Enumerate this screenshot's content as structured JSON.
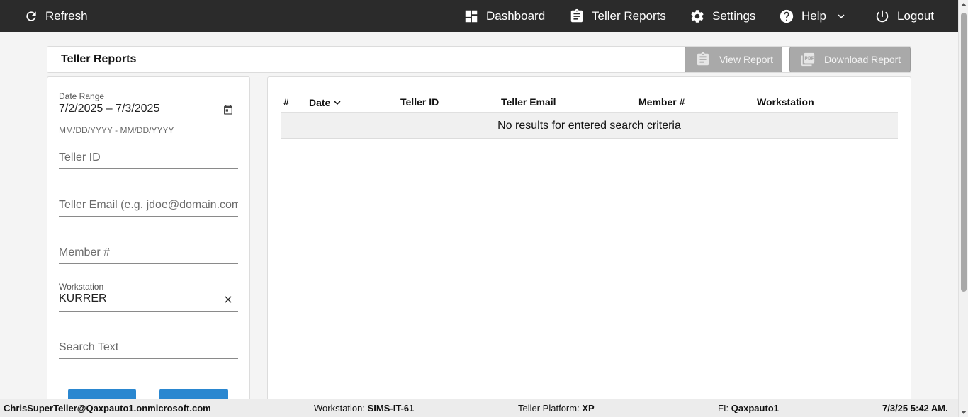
{
  "topbar": {
    "refresh": "Refresh",
    "dashboard": "Dashboard",
    "teller_reports": "Teller Reports",
    "settings": "Settings",
    "help": "Help",
    "logout": "Logout"
  },
  "page": {
    "title": "Teller Reports",
    "view_report": "View Report",
    "download_report": "Download Report"
  },
  "filters": {
    "date_range_label": "Date Range",
    "date_range_value": "7/2/2025 – 7/3/2025",
    "date_range_hint": "MM/DD/YYYY - MM/DD/YYYY",
    "teller_id_placeholder": "Teller ID",
    "teller_email_placeholder": "Teller Email (e.g. jdoe@domain.com)",
    "member_placeholder": "Member #",
    "workstation_label": "Workstation",
    "workstation_value": "KURRER",
    "search_text_placeholder": "Search Text"
  },
  "table": {
    "columns": [
      "#",
      "Date",
      "Teller ID",
      "Teller Email",
      "Member #",
      "Workstation"
    ],
    "empty_message": "No results for entered search criteria"
  },
  "status": {
    "user": "ChrisSuperTeller@Qaxpauto1.onmicrosoft.com",
    "workstation_label": "Workstation:",
    "workstation_value": "SIMS-IT-61",
    "platform_label": "Teller Platform:",
    "platform_value": "XP",
    "fi_label": "FI:",
    "fi_value": "Qaxpauto1",
    "datetime": "7/3/25 5:42 AM."
  },
  "colors": {
    "topbar": "#2b2b2b",
    "button_gray": "#a9a9a9",
    "button_blue": "#2a87d0",
    "statusbar": "#ececec"
  }
}
